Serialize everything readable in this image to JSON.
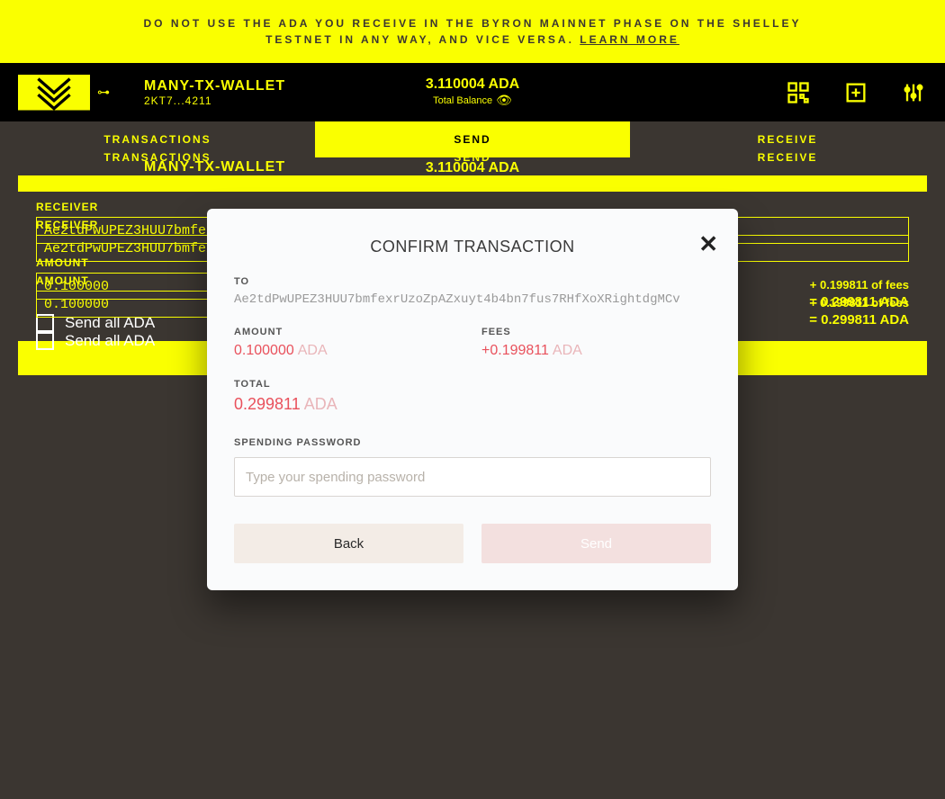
{
  "banner": {
    "line1": "DO NOT USE THE ADA YOU RECEIVE IN THE BYRON MAINNET PHASE ON THE SHELLEY",
    "line2": "TESTNET IN ANY WAY, AND VICE VERSA.",
    "link": "LEARN MORE"
  },
  "wallet": {
    "name": "MANY-TX-WALLET",
    "sub": "2KT7...4211",
    "balance_main": "3.110004 ADA",
    "balance_sub": "Total Balance"
  },
  "tabs": {
    "t1": "TRANSACTIONS",
    "t2": "SEND",
    "t3": "RECEIVE"
  },
  "form": {
    "receiver_label": "RECEIVER",
    "receiver_value": "Ae2tdPwUPEZ3HUU7bmfexrUzoZpAZxuyt4b4bn7fus7RHfXoXRightdgMCv",
    "amount_label": "AMOUNT",
    "amount_value": "0.100000",
    "fees_note": "+ 0.199811 of fees",
    "total_note": "= 0.299811 ADA",
    "sendall": "Send all ADA"
  },
  "modal": {
    "title": "CONFIRM TRANSACTION",
    "to_label": "TO",
    "to_value": "Ae2tdPwUPEZ3HUU7bmfexrUzoZpAZxuyt4b4bn7fus7RHfXoXRightdgMCv",
    "amount_label": "AMOUNT",
    "amount_num": "0.100000",
    "amount_unit": "ADA",
    "fees_label": "FEES",
    "fees_num": "+0.199811",
    "fees_unit": "ADA",
    "total_label": "TOTAL",
    "total_num": "0.299811",
    "total_unit": "ADA",
    "pw_label": "SPENDING PASSWORD",
    "pw_placeholder": "Type your spending password",
    "back": "Back",
    "send": "Send"
  }
}
